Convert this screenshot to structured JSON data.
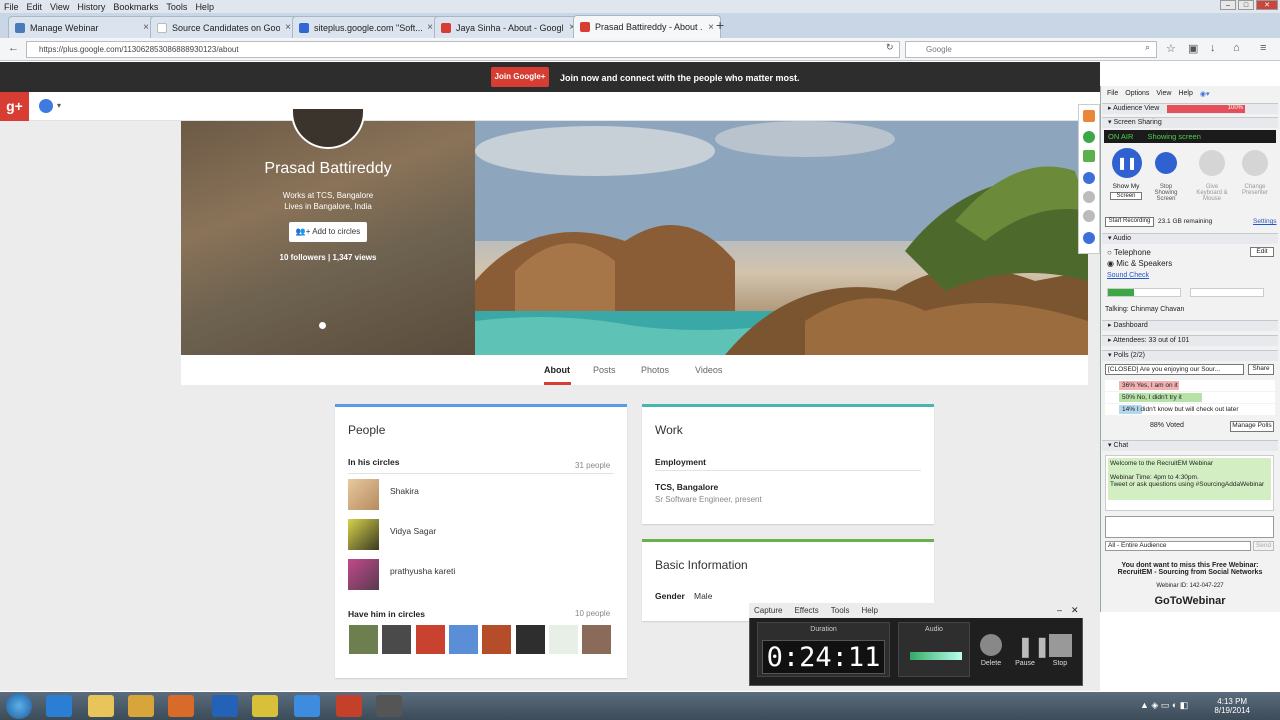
{
  "browser": {
    "menu": [
      "File",
      "Edit",
      "View",
      "History",
      "Bookmarks",
      "Tools",
      "Help"
    ],
    "tabs": [
      {
        "label": "Manage Webinar",
        "color": "#4a7ab8"
      },
      {
        "label": "Source Candidates on Google ...",
        "color": "#ffffff"
      },
      {
        "label": "siteplus.google.com \"Soft...",
        "color": "#3367d6"
      },
      {
        "label": "Jaya Sinha - About - Googl...",
        "color": "#d73d32"
      },
      {
        "label": "Prasad Battireddy - About ...",
        "color": "#d73d32"
      }
    ],
    "url": "https://plus.google.com/113062853086888930123/about",
    "search_placeholder": "Google"
  },
  "gplus": {
    "join_button": "Join Google+",
    "join_text": "Join now and connect with the people who matter most.",
    "logo": "g+",
    "profile": {
      "name": "Prasad Battireddy",
      "work": "Works at TCS, Bangalore",
      "lives": "Lives in Bangalore, India",
      "add_button": "Add to circles",
      "followers": "10 followers | 1,347 views"
    },
    "tabs": [
      "About",
      "Posts",
      "Photos",
      "Videos"
    ],
    "people": {
      "title": "People",
      "in_circles_label": "In his circles",
      "in_circles_count": "31 people",
      "members": [
        "Shakira",
        "Vidya Sagar",
        "prathyusha kareti"
      ],
      "have_him_label": "Have him in circles",
      "have_him_count": "10 people"
    },
    "work": {
      "title": "Work",
      "employment_label": "Employment",
      "employer": "TCS, Bangalore",
      "role": "Sr Software Engineer, present"
    },
    "basic": {
      "title": "Basic Information",
      "gender_label": "Gender",
      "gender_value": "Male"
    }
  },
  "gtw": {
    "menu": [
      "File",
      "Options",
      "View",
      "Help"
    ],
    "audience_view": "Audience View",
    "audience_pct": "100%",
    "screen_sharing": "Screen Sharing",
    "on_air": "ON AIR",
    "showing_screen": "Showing screen",
    "show_my": "Show My",
    "screen_select": "Screen",
    "stop_showing": "Stop Showing Screen",
    "give_keyboard": "Give Keyboard & Mouse",
    "change_presenter": "Change Presenter",
    "start_recording": "Start Recording",
    "gb_remaining": "23.1 GB remaining",
    "settings": "Settings",
    "audio": "Audio",
    "telephone": "Telephone",
    "mic": "Mic & Speakers",
    "edit": "Edit",
    "sound_check": "Sound Check",
    "talking": "Talking: Chinmay Chavan",
    "dashboard": "Dashboard",
    "attendees": "Attendees: 33 out of 101",
    "polls": "Polls (2/2)",
    "poll_question": "[CLOSED] Are you enjoying our Sour...",
    "share": "Share",
    "poll_options": [
      "36% Yes, I am on it",
      "50% No, I didn't try it",
      "14% I didn't know but will check out later"
    ],
    "voted": "88% Voted",
    "manage_polls": "Manage Polls",
    "chat": "Chat",
    "chat_text": "Welcome to the RecruitEM Webinar\n\nWebinar Time: 4pm to 4:30pm.\nTweet or ask questions using #SourcingAddaWebinar",
    "audience_select": "All - Entire Audience",
    "send": "Send",
    "promo": "You dont want to miss this Free Webinar: RecruitEM - Sourcing from Social Networks",
    "webinar_id": "Webinar ID: 142-047-227",
    "brand": "GoToWebinar"
  },
  "recorder": {
    "menu": [
      "Capture",
      "Effects",
      "Tools",
      "Help"
    ],
    "duration_label": "Duration",
    "duration": "0:24:11",
    "audio_label": "Audio",
    "delete": "Delete",
    "pause": "Pause",
    "stop": "Stop"
  },
  "taskbar": {
    "time": "4:13 PM",
    "date": "8/19/2014"
  }
}
